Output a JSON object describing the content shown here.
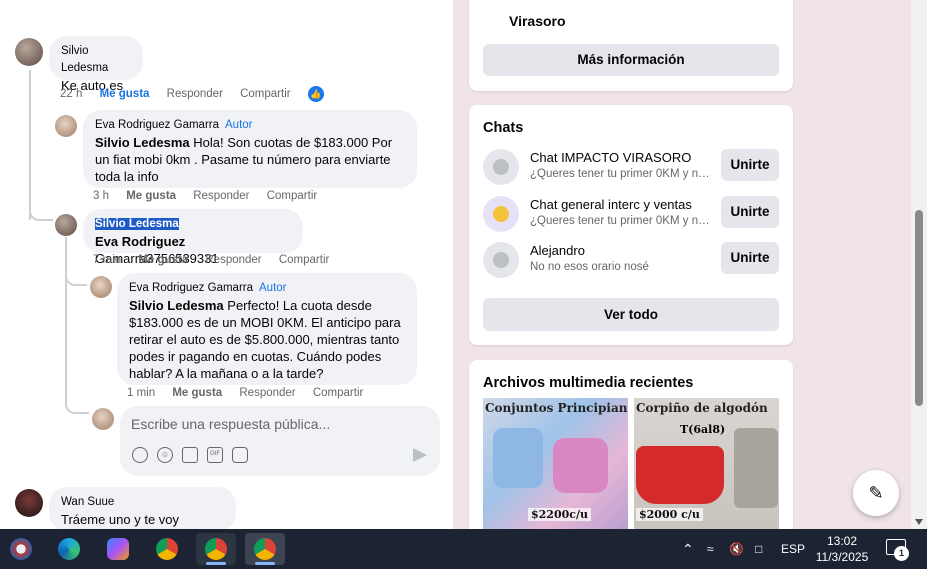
{
  "comments": {
    "c1": {
      "author": "Silvio Ledesma",
      "text": "Ke auto es",
      "time": "22 h",
      "like": "Me gusta",
      "reply": "Responder",
      "share": "Compartir"
    },
    "c2": {
      "author": "Eva Rodriguez Gamarra",
      "badge": "Autor",
      "mention": "Silvio Ledesma",
      "text": "Hola! Son cuotas de $183.000 Por un fiat mobi 0km . Pasame tu número para enviarte toda la info",
      "time": "3 h",
      "like": "Me gusta",
      "reply": "Responder",
      "share": "Compartir"
    },
    "c3": {
      "author": "Silvio Ledesma",
      "mention": "Eva Rodriguez",
      "text": "Gamarra3756539331",
      "time": "7 min",
      "like": "Me gusta",
      "reply": "Responder",
      "share": "Compartir"
    },
    "c4": {
      "author": "Eva Rodriguez Gamarra",
      "badge": "Autor",
      "mention": "Silvio Ledesma",
      "text": "Perfecto! La cuota desde $183.000 es de un MOBI 0KM. El anticipo para retirar el auto es de $5.800.000, mientras tanto podes ir pagando en cuotas. Cuándo podes hablar? A la mañana o a la tarde?",
      "time": "1 min",
      "like": "Me gusta",
      "reply": "Responder",
      "share": "Compartir"
    },
    "c5": {
      "author": "Wan Suue",
      "text": "Tráeme uno y te voy pagando"
    }
  },
  "reply_box": {
    "placeholder": "Escribe una respuesta pública..."
  },
  "group_card": {
    "partial_name": "Virasoro",
    "more_info": "Más información"
  },
  "chats": {
    "title": "Chats",
    "items": [
      {
        "name": "Chat IMPACTO VIRASORO",
        "sub": "¿Queres tener tu primer 0KM y no t...",
        "action": "Unirte"
      },
      {
        "name": "Chat general interc y ventas",
        "sub": "¿Queres tener tu primer 0KM y no t...",
        "action": "Unirte"
      },
      {
        "name": "Alejandro",
        "sub": "No no esos orario nosé",
        "action": "Unirte"
      }
    ],
    "see_all": "Ver todo"
  },
  "media": {
    "title": "Archivos multimedia recientes",
    "items": [
      {
        "label": "Conjuntos  Principiant",
        "price": "$2200c/u"
      },
      {
        "label": "Corpiño de algodón",
        "sublabel": "T(6al8)",
        "price": "$2000 c/u"
      }
    ]
  },
  "taskbar": {
    "lang": "ESP",
    "time": "13:02",
    "date": "11/3/2025",
    "notifications": "1"
  },
  "colors": {
    "accent": "#1b74e4",
    "author_badge": "#1b74e4",
    "taskbar": "#1c2433"
  }
}
